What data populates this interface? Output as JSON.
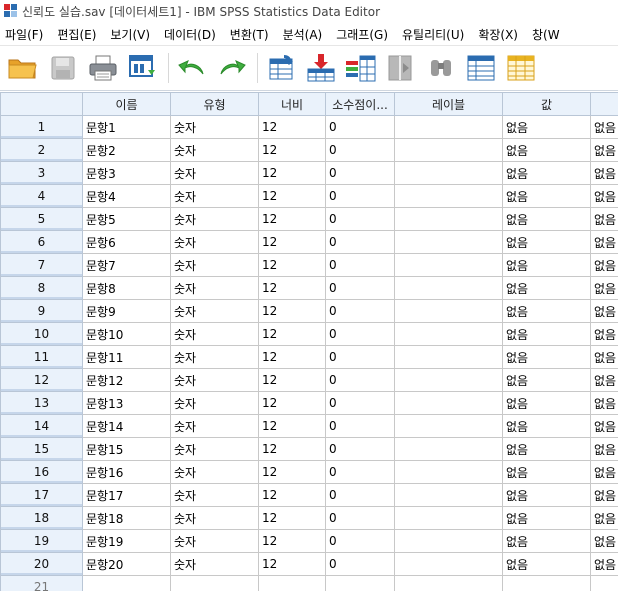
{
  "window": {
    "title": "신뢰도 실습.sav [데이터세트1] - IBM SPSS Statistics Data Editor",
    "app_icon": "spss-data-editor-icon"
  },
  "menu": [
    {
      "label": "파일(F)",
      "name": "menu-file"
    },
    {
      "label": "편집(E)",
      "name": "menu-edit"
    },
    {
      "label": "보기(V)",
      "name": "menu-view"
    },
    {
      "label": "데이터(D)",
      "name": "menu-data"
    },
    {
      "label": "변환(T)",
      "name": "menu-transform"
    },
    {
      "label": "분석(A)",
      "name": "menu-analyze"
    },
    {
      "label": "그래프(G)",
      "name": "menu-graphs"
    },
    {
      "label": "유틸리티(U)",
      "name": "menu-utilities"
    },
    {
      "label": "확장(X)",
      "name": "menu-extensions"
    },
    {
      "label": "창(W",
      "name": "menu-window"
    }
  ],
  "toolbar": [
    {
      "icon": "open-folder-icon",
      "name": "open-button"
    },
    {
      "icon": "save-icon",
      "name": "save-button",
      "disabled": true
    },
    {
      "icon": "print-icon",
      "name": "print-button"
    },
    {
      "icon": "dialog-recall-icon",
      "name": "dialog-recall-button"
    },
    {
      "icon": "undo-icon",
      "name": "undo-button"
    },
    {
      "icon": "redo-icon",
      "name": "redo-button"
    },
    {
      "icon": "goto-case-icon",
      "name": "goto-case-button"
    },
    {
      "icon": "insert-case-icon",
      "name": "insert-case-button"
    },
    {
      "icon": "insert-variable-icon",
      "name": "insert-variable-button"
    },
    {
      "icon": "split-file-icon",
      "name": "split-file-button",
      "disabled": true
    },
    {
      "icon": "find-icon",
      "name": "find-button",
      "disabled": true
    },
    {
      "icon": "variables-icon",
      "name": "variables-button"
    },
    {
      "icon": "value-labels-icon",
      "name": "value-labels-button"
    },
    {
      "icon": "use-sets-icon",
      "name": "use-sets-button",
      "disabled": true
    }
  ],
  "colors": {
    "header_bg": "#eaf2fb",
    "grid_line": "#c8c8c8",
    "undo_green": "#3fae3f",
    "insert_red": "#d8262b",
    "grid_blue": "#2b6cb0"
  },
  "columns": [
    {
      "label": "이름"
    },
    {
      "label": "유형"
    },
    {
      "label": "너비"
    },
    {
      "label": "소수점이..."
    },
    {
      "label": "레이블"
    },
    {
      "label": "값"
    },
    {
      "label": "결"
    }
  ],
  "rows": [
    {
      "num": "1",
      "name": "문항1",
      "type": "숫자",
      "width": "12",
      "decimals": "0",
      "label": "",
      "values": "없음",
      "missing": "없음"
    },
    {
      "num": "2",
      "name": "문항2",
      "type": "숫자",
      "width": "12",
      "decimals": "0",
      "label": "",
      "values": "없음",
      "missing": "없음"
    },
    {
      "num": "3",
      "name": "문항3",
      "type": "숫자",
      "width": "12",
      "decimals": "0",
      "label": "",
      "values": "없음",
      "missing": "없음"
    },
    {
      "num": "4",
      "name": "문항4",
      "type": "숫자",
      "width": "12",
      "decimals": "0",
      "label": "",
      "values": "없음",
      "missing": "없음"
    },
    {
      "num": "5",
      "name": "문항5",
      "type": "숫자",
      "width": "12",
      "decimals": "0",
      "label": "",
      "values": "없음",
      "missing": "없음"
    },
    {
      "num": "6",
      "name": "문항6",
      "type": "숫자",
      "width": "12",
      "decimals": "0",
      "label": "",
      "values": "없음",
      "missing": "없음"
    },
    {
      "num": "7",
      "name": "문항7",
      "type": "숫자",
      "width": "12",
      "decimals": "0",
      "label": "",
      "values": "없음",
      "missing": "없음"
    },
    {
      "num": "8",
      "name": "문항8",
      "type": "숫자",
      "width": "12",
      "decimals": "0",
      "label": "",
      "values": "없음",
      "missing": "없음"
    },
    {
      "num": "9",
      "name": "문항9",
      "type": "숫자",
      "width": "12",
      "decimals": "0",
      "label": "",
      "values": "없음",
      "missing": "없음"
    },
    {
      "num": "10",
      "name": "문항10",
      "type": "숫자",
      "width": "12",
      "decimals": "0",
      "label": "",
      "values": "없음",
      "missing": "없음"
    },
    {
      "num": "11",
      "name": "문항11",
      "type": "숫자",
      "width": "12",
      "decimals": "0",
      "label": "",
      "values": "없음",
      "missing": "없음"
    },
    {
      "num": "12",
      "name": "문항12",
      "type": "숫자",
      "width": "12",
      "decimals": "0",
      "label": "",
      "values": "없음",
      "missing": "없음"
    },
    {
      "num": "13",
      "name": "문항13",
      "type": "숫자",
      "width": "12",
      "decimals": "0",
      "label": "",
      "values": "없음",
      "missing": "없음"
    },
    {
      "num": "14",
      "name": "문항14",
      "type": "숫자",
      "width": "12",
      "decimals": "0",
      "label": "",
      "values": "없음",
      "missing": "없음"
    },
    {
      "num": "15",
      "name": "문항15",
      "type": "숫자",
      "width": "12",
      "decimals": "0",
      "label": "",
      "values": "없음",
      "missing": "없음"
    },
    {
      "num": "16",
      "name": "문항16",
      "type": "숫자",
      "width": "12",
      "decimals": "0",
      "label": "",
      "values": "없음",
      "missing": "없음"
    },
    {
      "num": "17",
      "name": "문항17",
      "type": "숫자",
      "width": "12",
      "decimals": "0",
      "label": "",
      "values": "없음",
      "missing": "없음"
    },
    {
      "num": "18",
      "name": "문항18",
      "type": "숫자",
      "width": "12",
      "decimals": "0",
      "label": "",
      "values": "없음",
      "missing": "없음"
    },
    {
      "num": "19",
      "name": "문항19",
      "type": "숫자",
      "width": "12",
      "decimals": "0",
      "label": "",
      "values": "없음",
      "missing": "없음"
    },
    {
      "num": "20",
      "name": "문항20",
      "type": "숫자",
      "width": "12",
      "decimals": "0",
      "label": "",
      "values": "없음",
      "missing": "없음"
    },
    {
      "num": "21",
      "name": "",
      "type": "",
      "width": "",
      "decimals": "",
      "label": "",
      "values": "",
      "missing": ""
    }
  ]
}
